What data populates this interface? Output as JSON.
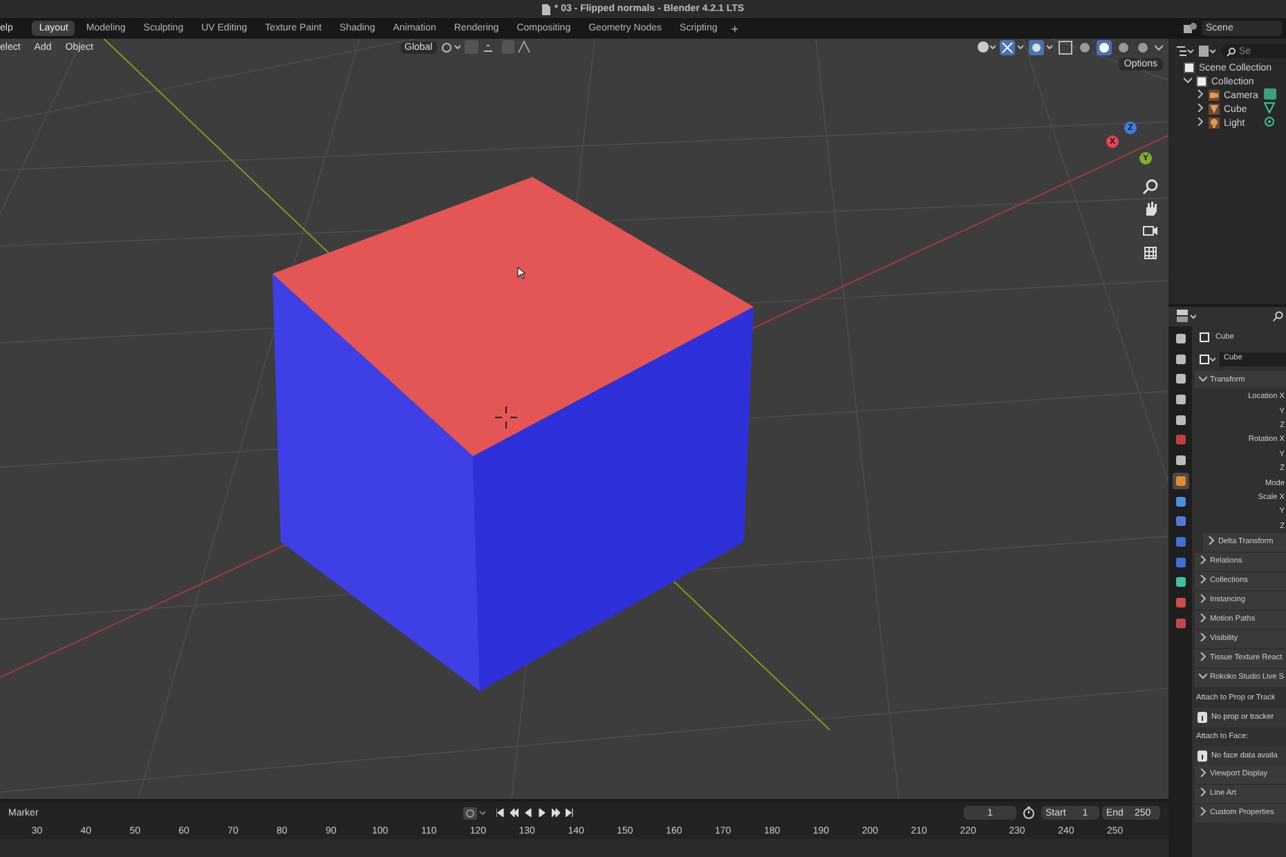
{
  "window": {
    "title": "* 03 - Flipped normals - Blender 4.2.1 LTS"
  },
  "menu": [
    "elp"
  ],
  "workspaces": [
    {
      "label": "Layout",
      "selected": true
    },
    {
      "label": "Modeling",
      "selected": false
    },
    {
      "label": "Sculpting",
      "selected": false
    },
    {
      "label": "UV Editing",
      "selected": false
    },
    {
      "label": "Texture Paint",
      "selected": false
    },
    {
      "label": "Shading",
      "selected": false
    },
    {
      "label": "Animation",
      "selected": false
    },
    {
      "label": "Rendering",
      "selected": false
    },
    {
      "label": "Compositing",
      "selected": false
    },
    {
      "label": "Geometry Nodes",
      "selected": false
    },
    {
      "label": "Scripting",
      "selected": false
    }
  ],
  "add_workspace": "+",
  "scene": "Scene",
  "viewport": {
    "menu": [
      "elect",
      "Add",
      "Object"
    ],
    "orientation": "Global",
    "options": "Options",
    "gizmo_axes": [
      "X",
      "Y",
      "Z"
    ],
    "shading": [
      {
        "selected": false
      },
      {
        "selected": true
      },
      {
        "selected": false
      },
      {
        "selected": false
      }
    ]
  },
  "outliner": {
    "search_placeholder": "Se",
    "items": [
      {
        "label": "Scene Collection",
        "kind": "collection",
        "children": [
          {
            "label": "Collection",
            "kind": "collection",
            "expanded": true,
            "children": [
              {
                "label": "Camera",
                "kind": "camera",
                "expanded": false
              },
              {
                "label": "Cube",
                "kind": "mesh",
                "expanded": false
              },
              {
                "label": "Light",
                "kind": "light",
                "expanded": false
              }
            ]
          }
        ]
      }
    ]
  },
  "properties": {
    "tabs": [
      {
        "selected": false
      },
      {
        "selected": false
      },
      {
        "selected": false
      },
      {
        "selected": false
      },
      {
        "selected": false
      },
      {
        "selected": false
      },
      {
        "selected": false
      },
      {
        "selected": true
      },
      {
        "selected": false
      },
      {
        "selected": false
      },
      {
        "selected": false
      },
      {
        "selected": false
      },
      {
        "selected": false
      },
      {
        "selected": false
      },
      {
        "selected": false
      }
    ],
    "object_name": "Cube",
    "data_name": "Cube",
    "panels": [
      {
        "label": "Transform",
        "expanded": true,
        "fields": [
          "Location X",
          "Y",
          "Z",
          "Rotation X",
          "Y",
          "Z",
          "Mode",
          "Scale X",
          "Y",
          "Z"
        ],
        "subpanels": [
          {
            "label": "Delta Transform",
            "expanded": false
          }
        ]
      },
      {
        "label": "Relations",
        "expanded": false
      },
      {
        "label": "Collections",
        "expanded": false
      },
      {
        "label": "Instancing",
        "expanded": false
      },
      {
        "label": "Motion Paths",
        "expanded": false
      },
      {
        "label": "Visibility",
        "expanded": false
      },
      {
        "label": "Tissue Texture React",
        "expanded": false
      },
      {
        "label": "Rokoko Studio Live S",
        "expanded": true,
        "content": [
          {
            "kind": "heading",
            "text": "Attach to Prop or Track"
          },
          {
            "kind": "info",
            "text": "No prop or tracker"
          },
          {
            "kind": "heading",
            "text": "Attach to Face:"
          },
          {
            "kind": "info",
            "text": "No face data availa"
          }
        ]
      },
      {
        "label": "Viewport Display",
        "expanded": false
      },
      {
        "label": "Line Art",
        "expanded": false
      },
      {
        "label": "Custom Properties",
        "expanded": false
      }
    ]
  },
  "timeline": {
    "menu": "Marker",
    "current_frame": "1",
    "start_label": "Start",
    "start": "1",
    "end_label": "End",
    "end": "250",
    "ruler": [
      "30",
      "40",
      "50",
      "60",
      "70",
      "80",
      "90",
      "100",
      "110",
      "120",
      "130",
      "140",
      "150",
      "160",
      "170",
      "180",
      "190",
      "200",
      "210",
      "220",
      "230",
      "240",
      "250"
    ]
  }
}
